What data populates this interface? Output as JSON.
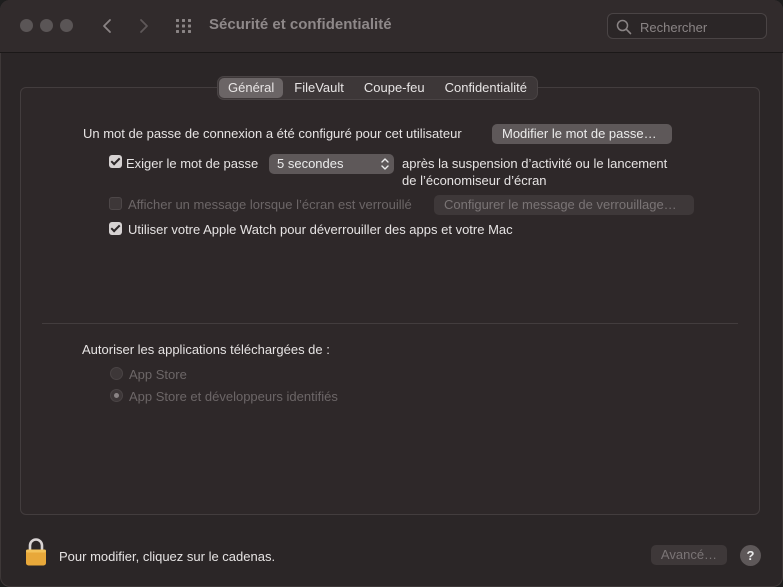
{
  "window": {
    "title": "Sécurité et confidentialité",
    "search_placeholder": "Rechercher"
  },
  "tabs": [
    {
      "label": "Général",
      "active": true
    },
    {
      "label": "FileVault",
      "active": false
    },
    {
      "label": "Coupe-feu",
      "active": false
    },
    {
      "label": "Confidentialité",
      "active": false
    }
  ],
  "general": {
    "password_set_text": "Un mot de passe de connexion a été configuré pour cet utilisateur",
    "change_password_button": "Modifier le mot de passe…",
    "require_password": {
      "label": "Exiger le mot de passe",
      "checked": true,
      "delay_value": "5 secondes",
      "after_text_line1": "après la suspension d’activité ou le lancement",
      "after_text_line2": "de l’économiseur d’écran"
    },
    "lock_message": {
      "label": "Afficher un message lorsque l’écran est verrouillé",
      "checked": false,
      "enabled": false,
      "button": "Configurer le message de verrouillage…"
    },
    "apple_watch": {
      "label": "Utiliser votre Apple Watch pour déverrouiller des apps et votre Mac",
      "checked": true
    },
    "allow_apps": {
      "heading": "Autoriser les applications téléchargées de :",
      "options": [
        {
          "label": "App Store",
          "selected": false
        },
        {
          "label": "App Store et développeurs identifiés",
          "selected": true
        }
      ]
    }
  },
  "footer": {
    "lock_text": "Pour modifier, cliquez sur le cadenas.",
    "advanced_button": "Avancé…",
    "help_label": "?"
  },
  "colors": {
    "window_bg": "#2b2627",
    "titlebar_bg": "#312b2c",
    "button_bg": "#5e5859",
    "lock_icon": "#e8a83a"
  },
  "icons": {
    "back": "chevron-left-icon",
    "forward": "chevron-right-icon",
    "show_all": "grid-icon",
    "search": "search-icon",
    "lock": "lock-icon"
  }
}
